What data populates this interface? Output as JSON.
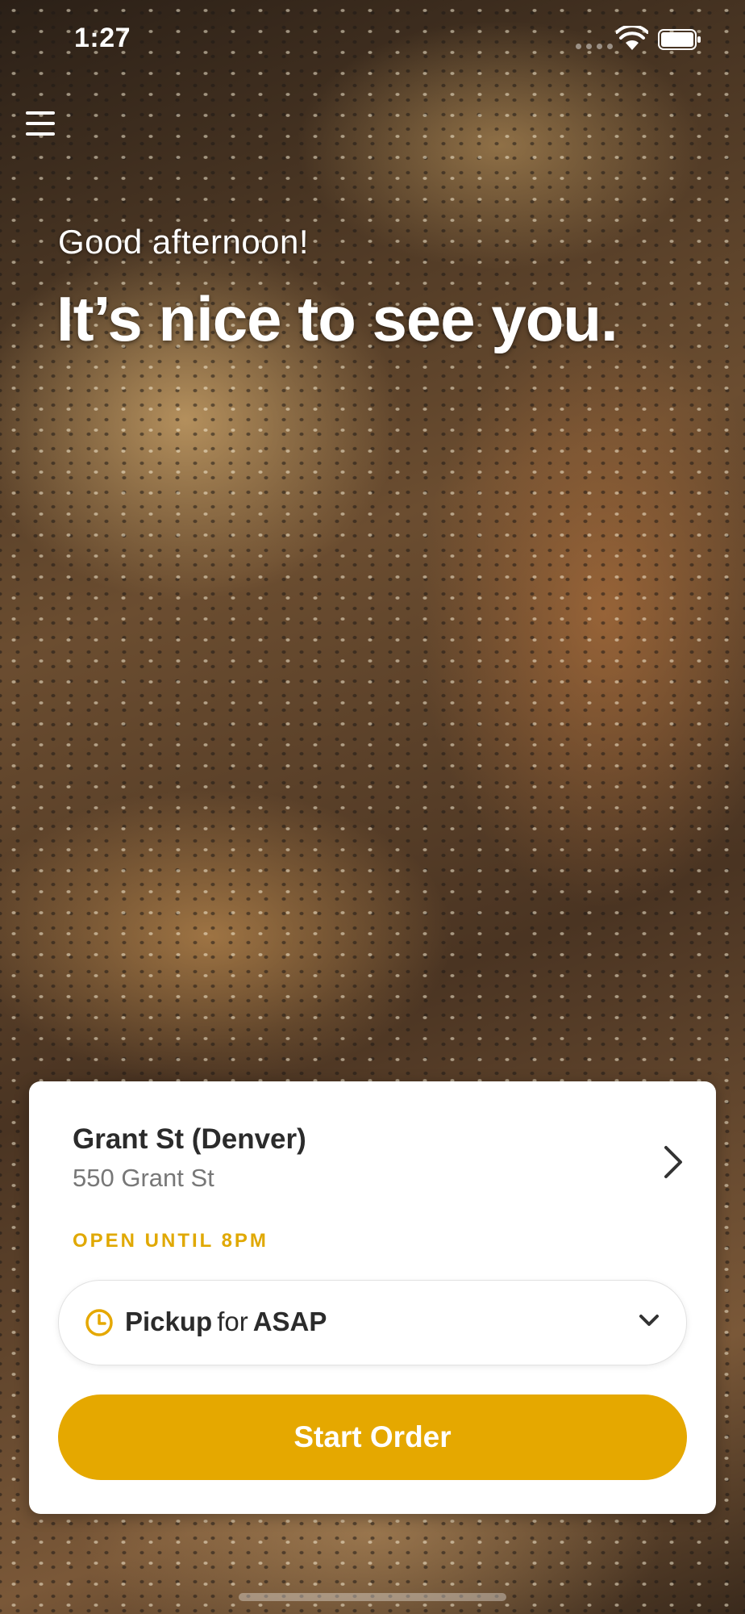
{
  "status_bar": {
    "time": "1:27",
    "icons": [
      "cellular-signal-icon",
      "wifi-icon",
      "battery-icon"
    ]
  },
  "header": {
    "menu_icon": "hamburger-menu-icon",
    "greeting": "Good afternoon!",
    "headline": "It’s nice to see you."
  },
  "store": {
    "name": "Grant St (Denver)",
    "address": "550 Grant St",
    "status": "OPEN UNTIL 8PM",
    "chevron_icon": "chevron-right-icon"
  },
  "order_mode": {
    "mode": "Pickup",
    "connector": "for",
    "time": "ASAP",
    "clock_icon": "clock-icon",
    "dropdown_icon": "chevron-down-icon"
  },
  "cta": {
    "label": "Start Order"
  },
  "colors": {
    "accent": "#e5a800",
    "status_text": "#e0a800",
    "card_bg": "#ffffff",
    "primary_text": "#2b2b2b",
    "secondary_text": "#777777"
  }
}
